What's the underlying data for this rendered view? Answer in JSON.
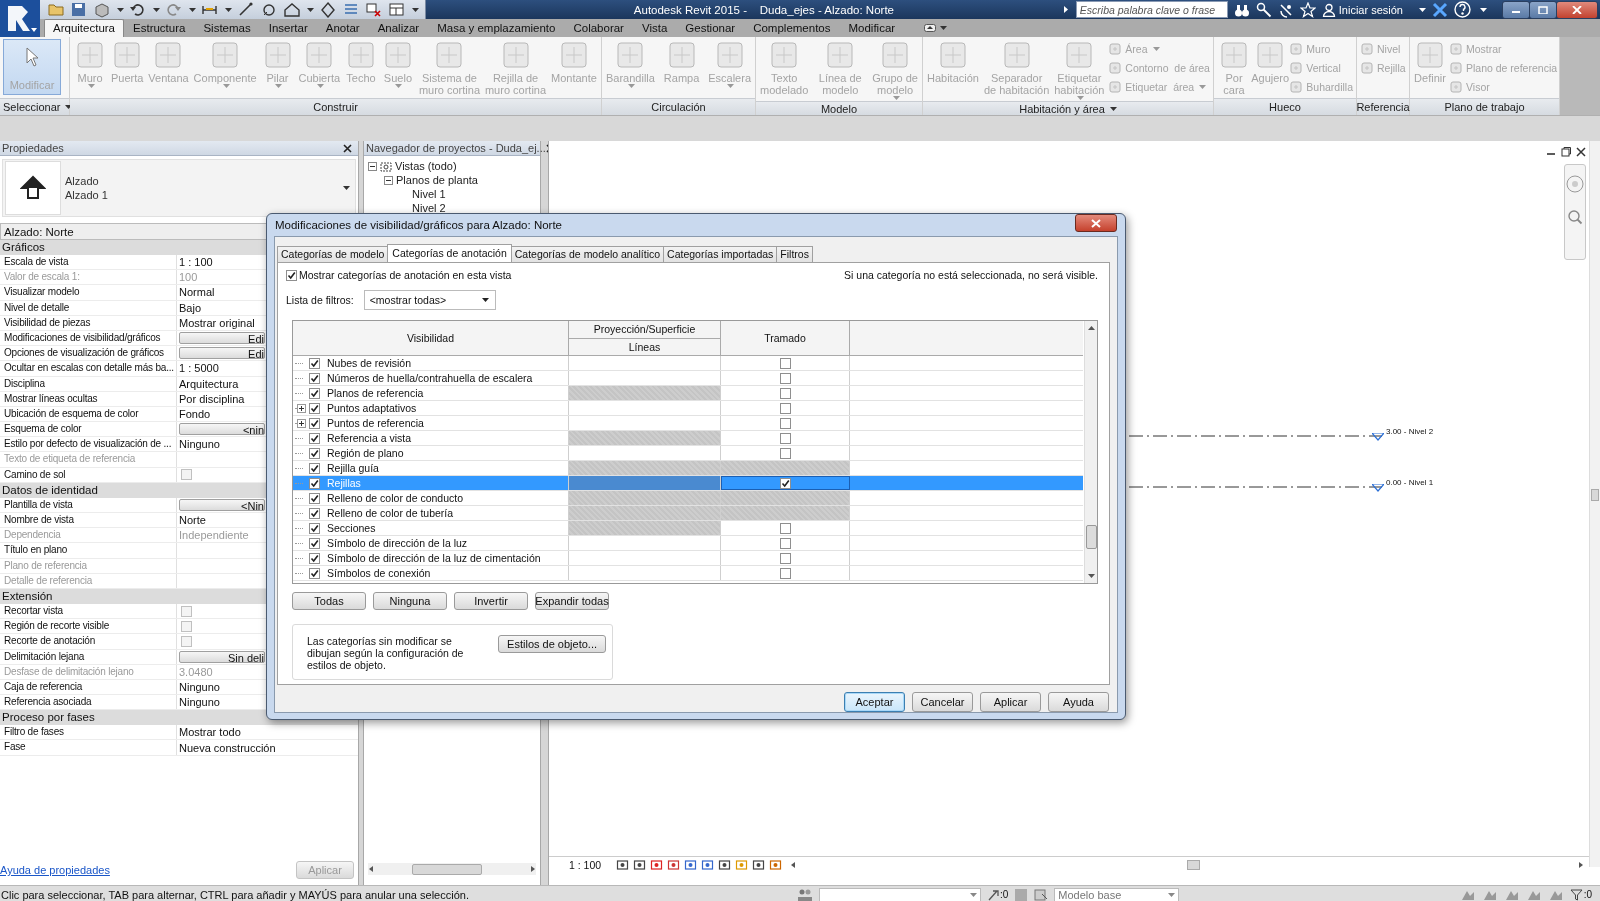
{
  "title_bar": {
    "title": "Autodesk Revit 2015 -    Duda_ejes - Alzado: Norte",
    "search_placeholder": "Escriba palabra clave o frase",
    "sign_in": "Iniciar sesión"
  },
  "ribbon_tabs": [
    {
      "label": "Arquitectura",
      "selected": true
    },
    {
      "label": "Estructura",
      "selected": false
    },
    {
      "label": "Sistemas",
      "selected": false
    },
    {
      "label": "Insertar",
      "selected": false
    },
    {
      "label": "Anotar",
      "selected": false
    },
    {
      "label": "Analizar",
      "selected": false
    },
    {
      "label": "Masa y emplazamiento",
      "selected": false
    },
    {
      "label": "Colaborar",
      "selected": false
    },
    {
      "label": "Vista",
      "selected": false
    },
    {
      "label": "Gestionar",
      "selected": false
    },
    {
      "label": "Complementos",
      "selected": false
    },
    {
      "label": "Modificar",
      "selected": false
    }
  ],
  "ribbon_panels": [
    {
      "label": "Seleccionar",
      "menu": true,
      "tools": [
        {
          "kind": "toggle",
          "label": "Modificar",
          "selected": true,
          "menu": false
        }
      ]
    },
    {
      "label": "Construir",
      "menu": false,
      "tools": [
        {
          "kind": "large",
          "label": "Muro",
          "menu": true
        },
        {
          "kind": "large",
          "label": "Puerta",
          "menu": false
        },
        {
          "kind": "large",
          "label": "Ventana",
          "menu": false
        },
        {
          "kind": "large",
          "label": "Componente",
          "menu": true
        },
        {
          "kind": "large",
          "label": "Pilar",
          "menu": true
        },
        {
          "kind": "large",
          "label": "Cubierta",
          "menu": true
        },
        {
          "kind": "large",
          "label": "Techo",
          "menu": false
        },
        {
          "kind": "large",
          "label": "Suelo",
          "menu": true
        },
        {
          "kind": "large",
          "label": "Sistema de\nmuro cortina",
          "menu": false
        },
        {
          "kind": "large",
          "label": "Rejilla de\nmuro cortina",
          "menu": false
        },
        {
          "kind": "large",
          "label": "Montante",
          "menu": false
        }
      ]
    },
    {
      "label": "Circulación",
      "menu": false,
      "tools": [
        {
          "kind": "large",
          "label": "Barandilla",
          "menu": true
        },
        {
          "kind": "large",
          "label": "Rampa",
          "menu": false
        },
        {
          "kind": "large",
          "label": "Escalera",
          "menu": true
        }
      ]
    },
    {
      "label": "Modelo",
      "menu": false,
      "tools": [
        {
          "kind": "large",
          "label": "Texto\nmodelado",
          "menu": false
        },
        {
          "kind": "large",
          "label": "Línea de\nmodelo",
          "menu": false
        },
        {
          "kind": "large",
          "label": "Grupo de\nmodelo",
          "menu": true
        }
      ]
    },
    {
      "label": "Habitación y área",
      "menu": true,
      "tools": [
        {
          "kind": "large",
          "label": "Habitación",
          "menu": false
        },
        {
          "kind": "large",
          "label": "Separador\nde habitación",
          "menu": false
        },
        {
          "kind": "large",
          "label": "Etiquetar\nhabitación",
          "menu": true
        },
        {
          "kind": "small",
          "label": "Área",
          "menu": true
        },
        {
          "kind": "small",
          "label": "Contorno  de área",
          "menu": false
        },
        {
          "kind": "small",
          "label": "Etiquetar  área",
          "menu": true
        }
      ]
    },
    {
      "label": "Hueco",
      "menu": false,
      "tools": [
        {
          "kind": "large",
          "label": "Por\ncara",
          "menu": false
        },
        {
          "kind": "large",
          "label": "Agujero",
          "menu": false
        },
        {
          "kind": "small",
          "label": "Muro",
          "menu": false
        },
        {
          "kind": "small",
          "label": "Vertical",
          "menu": false
        },
        {
          "kind": "small",
          "label": "Buhardilla",
          "menu": false
        }
      ]
    },
    {
      "label": "Referencia",
      "menu": false,
      "tools": [
        {
          "kind": "small",
          "label": "Nivel",
          "menu": false
        },
        {
          "kind": "small",
          "label": "Rejilla",
          "menu": false
        }
      ]
    },
    {
      "label": "Plano de trabajo",
      "menu": false,
      "tools": [
        {
          "kind": "large",
          "label": "Definir",
          "menu": false
        },
        {
          "kind": "small",
          "label": "Mostrar",
          "menu": false
        },
        {
          "kind": "small",
          "label": "Plano de referencia",
          "menu": false
        },
        {
          "kind": "small",
          "label": "Visor",
          "menu": false
        }
      ]
    }
  ],
  "properties": {
    "title": "Propiedades",
    "type_name": "Alzado",
    "type_sub": "Alzado 1",
    "instance": "Alzado: Norte",
    "sections": [
      {
        "title": "Gráficos",
        "rows": [
          {
            "label": "Escala de vista",
            "kind": "text",
            "value": "1 : 100",
            "disabled": false
          },
          {
            "label": "Valor de escala    1:",
            "kind": "text",
            "value": "100",
            "disabled": true
          },
          {
            "label": "Visualizar modelo",
            "kind": "text",
            "value": "Normal",
            "disabled": false
          },
          {
            "label": "Nivel de detalle",
            "kind": "text",
            "value": "Bajo",
            "disabled": false
          },
          {
            "label": "Visibilidad de piezas",
            "kind": "text",
            "value": "Mostrar original",
            "disabled": false
          },
          {
            "label": "Modificaciones de visibilidad/gráficos",
            "kind": "button",
            "value": "Edi",
            "disabled": false
          },
          {
            "label": "Opciones de visualización de gráficos",
            "kind": "button",
            "value": "Edi",
            "disabled": false
          },
          {
            "label": "Ocultar en escalas con detalle más ba...",
            "kind": "text",
            "value": "1 : 5000",
            "disabled": false
          },
          {
            "label": "Disciplina",
            "kind": "text",
            "value": "Arquitectura",
            "disabled": false
          },
          {
            "label": "Mostrar líneas ocultas",
            "kind": "text",
            "value": "Por disciplina",
            "disabled": false
          },
          {
            "label": "Ubicación de esquema de color",
            "kind": "text",
            "value": "Fondo",
            "disabled": false
          },
          {
            "label": "Esquema de color",
            "kind": "button",
            "value": "<nin",
            "disabled": false
          },
          {
            "label": "Estilo por defecto de visualización de ...",
            "kind": "text",
            "value": "Ninguno",
            "disabled": false
          },
          {
            "label": "Texto de etiqueta de referencia",
            "kind": "text",
            "disabled": true
          },
          {
            "label": "Camino de sol",
            "kind": "checkbox",
            "checked": false,
            "disabled": false
          }
        ]
      },
      {
        "title": "Datos de identidad",
        "rows": [
          {
            "label": "Plantilla de vista",
            "kind": "button",
            "value": "<Nin",
            "disabled": false
          },
          {
            "label": "Nombre de vista",
            "kind": "text",
            "value": "Norte",
            "disabled": false
          },
          {
            "label": "Dependencia",
            "kind": "text",
            "value": "Independiente",
            "disabled": true
          },
          {
            "label": "Título en plano",
            "kind": "text",
            "disabled": false
          },
          {
            "label": "Plano de referencia",
            "kind": "text",
            "disabled": true
          },
          {
            "label": "Detalle de referencia",
            "kind": "text",
            "disabled": true
          }
        ]
      },
      {
        "title": "Extensión",
        "rows": [
          {
            "label": "Recortar vista",
            "kind": "checkbox",
            "checked": false,
            "disabled": false
          },
          {
            "label": "Región de recorte visible",
            "kind": "checkbox",
            "checked": false,
            "disabled": false
          },
          {
            "label": "Recorte de anotación",
            "kind": "checkbox",
            "checked": false,
            "disabled": false
          },
          {
            "label": "Delimitación lejana",
            "kind": "button",
            "value": "Sin deli",
            "disabled": false
          },
          {
            "label": "Desfase de delimitación lejano",
            "kind": "text",
            "value": "3.0480",
            "disabled": true
          },
          {
            "label": "Caja de referencia",
            "kind": "text",
            "value": "Ninguno",
            "disabled": false
          },
          {
            "label": "Referencia asociada",
            "kind": "text",
            "value": "Ninguno",
            "disabled": false
          }
        ]
      },
      {
        "title": "Proceso por fases",
        "rows": [
          {
            "label": "Filtro de fases",
            "kind": "text",
            "value": "Mostrar todo",
            "disabled": false
          },
          {
            "label": "Fase",
            "kind": "text",
            "value": "Nueva construcción",
            "disabled": false
          }
        ]
      }
    ],
    "help_link": "Ayuda de propiedades",
    "apply": "Aplicar"
  },
  "project_browser": {
    "title": "Navegador de proyectos - Duda_ej...",
    "tree": [
      {
        "label": "Vistas (todo)",
        "expanded": true,
        "children": [
          {
            "label": "Planos de planta",
            "expanded": true,
            "children": [
              {
                "label": "Nivel 1"
              },
              {
                "label": "Nivel 2"
              }
            ]
          }
        ]
      }
    ]
  },
  "dialog": {
    "title": "Modificaciones de visibilidad/gráficos para Alzado: Norte",
    "tabs": [
      {
        "label": "Categorías de modelo",
        "selected": false
      },
      {
        "label": "Categorías de anotación",
        "selected": true
      },
      {
        "label": "Categorías de modelo analítico",
        "selected": false
      },
      {
        "label": "Categorías importadas",
        "selected": false
      },
      {
        "label": "Filtros",
        "selected": false
      }
    ],
    "show_checkbox": {
      "label": "Mostrar categorías de anotación en esta vista",
      "checked": true
    },
    "note": "Si una categoría no está seleccionada, no será visible.",
    "filter": {
      "label": "Lista de filtros:",
      "value": "<mostrar todas>"
    },
    "table": {
      "columns": {
        "visibility": "Visibilidad",
        "projection": "Proyección/Superficie",
        "lines": "Líneas",
        "halftone": "Tramado"
      },
      "rows": [
        {
          "name": "Nubes de revisión",
          "visible": true,
          "expandable": false,
          "lines_editable": true,
          "halftone_editable": true,
          "halftone": false,
          "selected": false
        },
        {
          "name": "Números de huella/contrahuella de escalera",
          "visible": true,
          "expandable": false,
          "lines_editable": true,
          "halftone_editable": true,
          "halftone": false,
          "selected": false
        },
        {
          "name": "Planos de referencia",
          "visible": true,
          "expandable": false,
          "lines_editable": false,
          "halftone_editable": true,
          "halftone": false,
          "selected": false
        },
        {
          "name": "Puntos adaptativos",
          "visible": true,
          "expandable": true,
          "lines_editable": true,
          "halftone_editable": true,
          "halftone": false,
          "selected": false
        },
        {
          "name": "Puntos de referencia",
          "visible": true,
          "expandable": true,
          "lines_editable": true,
          "halftone_editable": true,
          "halftone": false,
          "selected": false
        },
        {
          "name": "Referencia a vista",
          "visible": true,
          "expandable": false,
          "lines_editable": false,
          "halftone_editable": true,
          "halftone": false,
          "selected": false
        },
        {
          "name": "Región de plano",
          "visible": true,
          "expandable": false,
          "lines_editable": true,
          "halftone_editable": true,
          "halftone": false,
          "selected": false
        },
        {
          "name": "Rejilla guía",
          "visible": true,
          "expandable": false,
          "lines_editable": false,
          "halftone_editable": false,
          "selected": false
        },
        {
          "name": "Rejillas",
          "visible": true,
          "expandable": false,
          "lines_editable": false,
          "halftone_editable": true,
          "halftone": true,
          "selected": true
        },
        {
          "name": "Relleno de color de conducto",
          "visible": true,
          "expandable": false,
          "lines_editable": false,
          "halftone_editable": false,
          "selected": false
        },
        {
          "name": "Relleno de color de tubería",
          "visible": true,
          "expandable": false,
          "lines_editable": false,
          "halftone_editable": false,
          "selected": false
        },
        {
          "name": "Secciones",
          "visible": true,
          "expandable": false,
          "lines_editable": false,
          "halftone_editable": true,
          "halftone": false,
          "selected": false
        },
        {
          "name": "Símbolo de dirección de la luz",
          "visible": true,
          "expandable": false,
          "lines_editable": true,
          "halftone_editable": true,
          "halftone": false,
          "selected": false
        },
        {
          "name": "Símbolo de dirección de la luz de cimentación",
          "visible": true,
          "expandable": false,
          "lines_editable": true,
          "halftone_editable": true,
          "halftone": false,
          "selected": false
        },
        {
          "name": "Símbolos de conexión",
          "visible": true,
          "expandable": false,
          "lines_editable": true,
          "halftone_editable": true,
          "halftone": false,
          "selected": false
        }
      ]
    },
    "bulk_buttons": [
      "Todas",
      "Ninguna",
      "Invertir",
      "Expandir todas"
    ],
    "info": "Las categorías sin modificar se dibujan según la configuración de estilos de objeto.",
    "object_styles": "Estilos de objeto...",
    "buttons": [
      {
        "label": "Aceptar",
        "default": true
      },
      {
        "label": "Cancelar",
        "default": false
      },
      {
        "label": "Aplicar",
        "default": false
      },
      {
        "label": "Ayuda",
        "default": false
      }
    ]
  },
  "view": {
    "levels": [
      {
        "label": "3.00 - Nivel 2"
      },
      {
        "label": "0.00 - Nivel 1"
      }
    ],
    "scale": "1 : 100"
  },
  "status_bar": {
    "message": "Clic para seleccionar, TAB para alternar, CTRL para añadir y MAYÚS para anular una selección.",
    "selection_count": ":0",
    "model": "Modelo base",
    "filter_count": ":0"
  }
}
